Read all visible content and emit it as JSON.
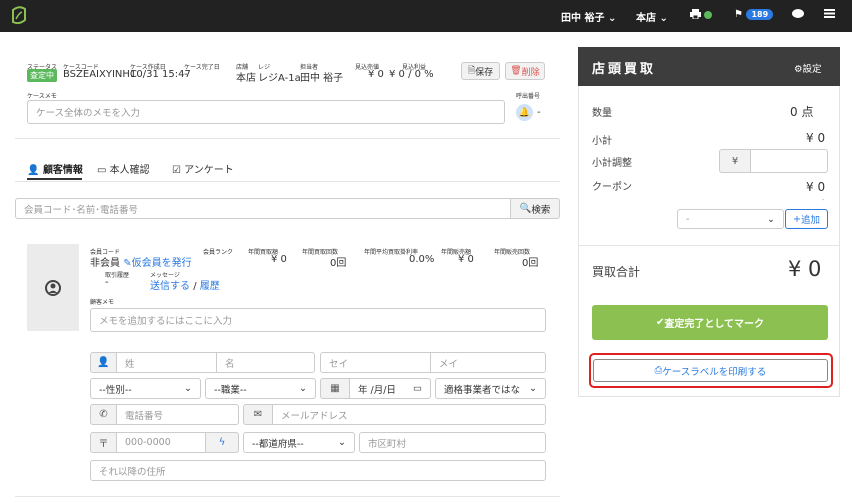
{
  "topbar": {
    "user": "田中 裕子",
    "store": "本店",
    "badge": "189"
  },
  "case": {
    "status_label": "ステータス",
    "status": "査定中",
    "code_label": "ケースコード",
    "code": "BSZEAIXYINHC",
    "created_label": "ケース作成日",
    "created": "10/31 15:47",
    "completed_label": "ケース完了日",
    "completed": "-",
    "shop_label": "店舗",
    "shop": "本店",
    "register_label": "レジ",
    "register": "レジA-1a",
    "staff_label": "担当者",
    "staff": "田中 裕子",
    "est_sale_label": "見込売値",
    "est_sale": "¥ 0",
    "est_margin_label": "見込利益",
    "est_margin": "¥ 0 / 0 %",
    "save": "保存",
    "delete": "削除",
    "memo_label": "ケースメモ",
    "memo_placeholder": "ケース全体のメモを入力",
    "call_label": "呼出番号",
    "call_value": "-"
  },
  "tabs": [
    "顧客情報",
    "本人確認",
    "アンケート"
  ],
  "search": {
    "placeholder": "会員コード･名前･電話番号",
    "button": "検索"
  },
  "customer": {
    "member_code_label": "会員コード",
    "member_type": "非会員",
    "issue_link": "仮会員を発行",
    "rank_label": "会員ランク",
    "annual_buy_amount_label": "年間買取額",
    "annual_buy_amount": "¥ 0",
    "annual_buy_count_label": "年間買取回数",
    "annual_buy_count": "0回",
    "avg_rate_label": "年間平均買取掛利率",
    "avg_rate": "0.0%",
    "annual_sale_amount_label": "年間販売額",
    "annual_sale_amount": "¥ 0",
    "annual_sale_count_label": "年間販売回数",
    "annual_sale_count": "0回",
    "history_label": "取引履歴",
    "history": "-",
    "message_label": "メッセージ",
    "send": "送信する",
    "sep": "/",
    "log": "履歴",
    "memo_label": "顧客メモ",
    "memo_placeholder": "メモを追加するにはここに入力"
  },
  "form": {
    "last_name": "姓",
    "first_name": "名",
    "last_kana": "セイ",
    "first_kana": "メイ",
    "gender": "--性別--",
    "job": "--職業--",
    "birthday": "年 /月/日",
    "business": "適格事業者ではな",
    "phone": "電話番号",
    "email": "メールアドレス",
    "postal_icon": "〒",
    "postal": "000-0000",
    "prefecture": "--都道府県--",
    "city": "市区町村",
    "address": "それ以降の住所"
  },
  "panel": {
    "title": "店頭買取",
    "settings": "設定",
    "quantity_label": "数量",
    "quantity": "0 点",
    "subtotal_label": "小計",
    "subtotal": "¥ 0",
    "adjust_label": "小計調整",
    "yen": "¥",
    "coupon_label": "クーポン",
    "coupon": "¥ 0",
    "coupon_sub": "-",
    "coupon_select": "-",
    "add": "追加",
    "total_label": "買取合計",
    "total": "¥ 0",
    "complete": "査定完了としてマーク",
    "print": "ケースラベルを印刷する"
  },
  "colors": {
    "topbar": "#222222",
    "panel_header": "#3d3d3d",
    "status": "#5cb85c",
    "delete": "#d9534f",
    "link": "#2a7ae2",
    "complete": "#8cc152",
    "highlight": "#e02020"
  }
}
